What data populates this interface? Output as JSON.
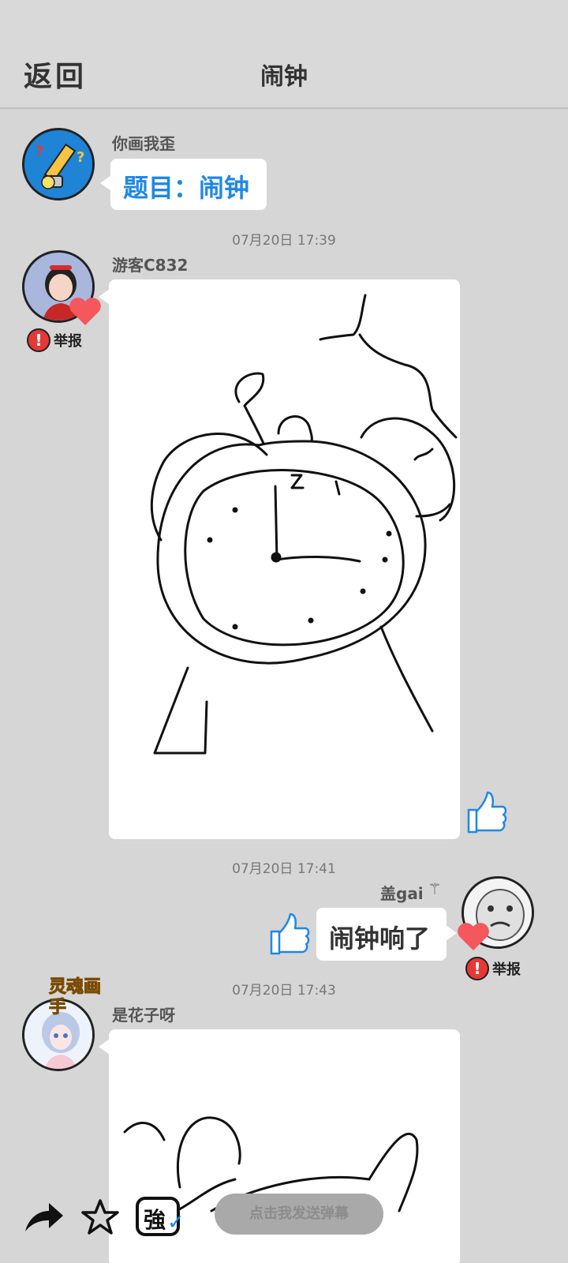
{
  "header": {
    "back_label": "返回",
    "title": "闹钟"
  },
  "messages": [
    {
      "user": "你画我歪",
      "text": "题目：闹钟"
    },
    {
      "timestamp": "07月20日  17:39",
      "user": "游客C832",
      "report_label": "举报"
    },
    {
      "timestamp": "07月20日  17:41",
      "user": "盖gai",
      "text": "闹钟响了",
      "report_label": "举报"
    },
    {
      "timestamp": "07月20日  17:43",
      "user": "是花子呀",
      "badge": "灵魂画手"
    }
  ],
  "bottom": {
    "danmaku_placeholder": "点击我发送弹幕",
    "strong_label": "強"
  },
  "colors": {
    "background": "#d6d6d6",
    "accent_blue": "#1e88e5",
    "report_red": "#e53935",
    "heart": "#f4575c"
  }
}
